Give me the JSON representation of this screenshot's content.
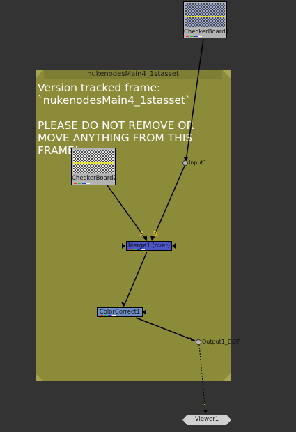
{
  "backdrop": {
    "title": "nukenodesMain4_1stasset",
    "label": "Version tracked frame:\n`nukenodesMain4_1stasset`\n\nPLEASE DO NOT REMOVE OR MOVE ANYTHING FROM THIS FRAME!",
    "color": "#8c8b3a"
  },
  "nodes": {
    "checkerboard1": "CheckerBoard1",
    "checkerboard2": "CheckerBoard2",
    "input1": "Input1",
    "merge1": "Merge1 (over)",
    "colorcorrect1": "ColorCorrect1",
    "output1": "Output1_DOT",
    "viewer1": "Viewer1"
  },
  "inputs": {
    "merge_a": "A",
    "merge_b": "B",
    "viewer_in": "1"
  },
  "colors": {
    "canvas": "#333333",
    "merge": "#4b55c6",
    "colorcorrect": "#6f90c6",
    "read_node": "#b3b3b3",
    "input_label": "#ffcf2a"
  }
}
